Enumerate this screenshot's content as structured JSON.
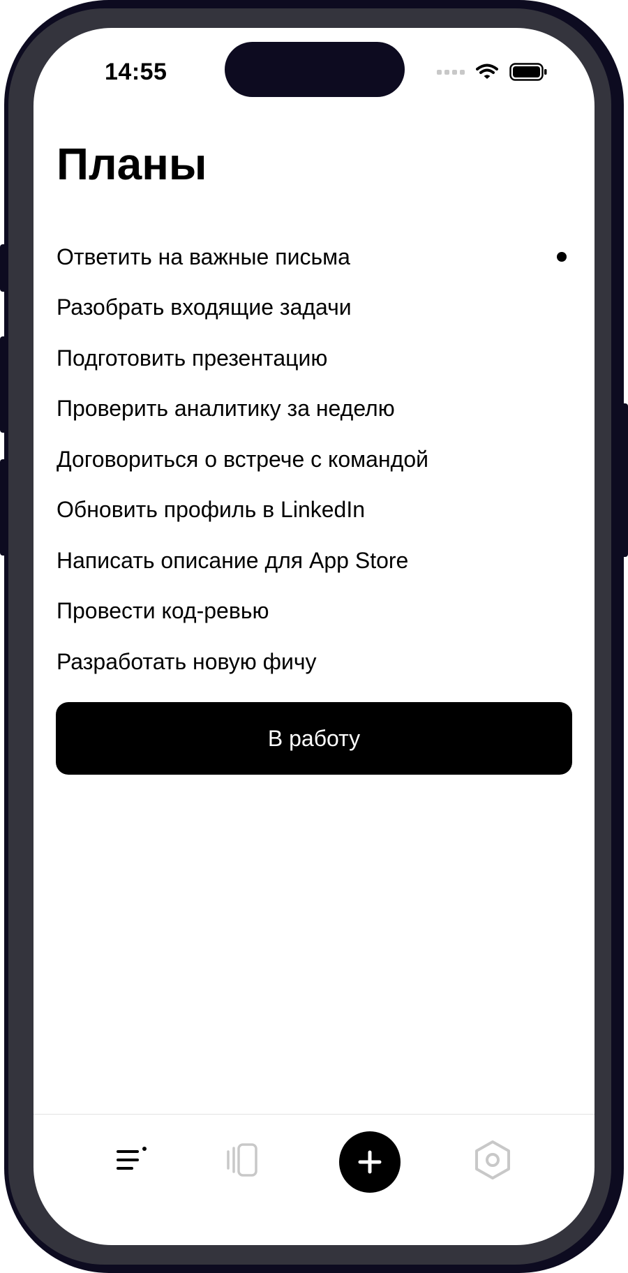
{
  "status_bar": {
    "time": "14:55",
    "icons": [
      "cellular-dots-icon",
      "wifi-icon",
      "battery-icon"
    ]
  },
  "page": {
    "title": "Планы"
  },
  "tasks": [
    {
      "label": "Ответить на важные письма",
      "marked": true
    },
    {
      "label": "Разобрать входящие задачи",
      "marked": false
    },
    {
      "label": "Подготовить презентацию",
      "marked": false
    },
    {
      "label": "Проверить аналитику за неделю",
      "marked": false
    },
    {
      "label": "Договориться о встрече с командой",
      "marked": false
    },
    {
      "label": "Обновить профиль в LinkedIn",
      "marked": false
    },
    {
      "label": "Написать описание для App Store",
      "marked": false
    },
    {
      "label": "Провести код-ревью",
      "marked": false
    },
    {
      "label": "Разработать новую фичу",
      "marked": false
    }
  ],
  "primary_action": {
    "label": "В работу"
  },
  "tab_bar": {
    "tabs": [
      {
        "icon": "list-icon",
        "active": true
      },
      {
        "icon": "cards-icon",
        "active": false
      },
      {
        "icon": "plus-icon",
        "active": false
      },
      {
        "icon": "settings-icon",
        "active": false
      }
    ]
  },
  "colors": {
    "background": "#ffffff",
    "text": "#000000",
    "inactive_icon": "#c8c8c8",
    "frame": "#0d0b20",
    "bezel": "#34343d"
  }
}
